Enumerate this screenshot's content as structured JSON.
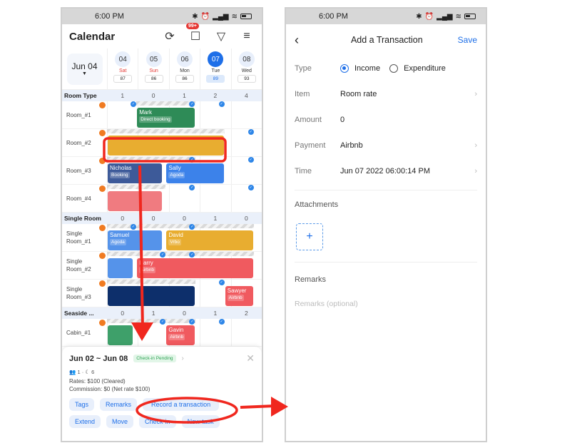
{
  "status_bar": {
    "time": "6:00 PM",
    "icons": [
      "bluetooth-icon",
      "alarm-icon",
      "signal-icon",
      "wifi-icon",
      "battery-icon"
    ]
  },
  "calendar": {
    "title": "Calendar",
    "header_icons": [
      "refresh-icon",
      "inbox-icon",
      "filter-icon",
      "menu-icon"
    ],
    "inbox_badge": "99+",
    "date_picker": {
      "label": "Jun 04"
    },
    "days": [
      {
        "num": "04",
        "name": "Sat",
        "count": "87",
        "weekend": true
      },
      {
        "num": "05",
        "name": "Sun",
        "count": "86",
        "weekend": true
      },
      {
        "num": "06",
        "name": "Mon",
        "count": "86",
        "weekend": false
      },
      {
        "num": "07",
        "name": "Tue",
        "count": "89",
        "today": true
      },
      {
        "num": "08",
        "name": "Wed",
        "count": "93",
        "weekend": false
      }
    ],
    "groups": [
      {
        "name": "Room Type",
        "counts": [
          "1",
          "0",
          "1",
          "2",
          "4"
        ],
        "rooms": [
          "Room_#1",
          "Room_#2",
          "Room_#3",
          "Room_#4"
        ]
      },
      {
        "name": "Single Room",
        "counts": [
          "0",
          "0",
          "0",
          "1",
          "0"
        ],
        "rooms": [
          "Single Room_#1",
          "Single Room_#2",
          "Single Room_#3"
        ]
      },
      {
        "name": "Seaside ...",
        "counts": [
          "0",
          "1",
          "0",
          "1",
          "2"
        ],
        "rooms": [
          "Cabin_#1"
        ]
      }
    ],
    "bookings": [
      {
        "guest": "Mark",
        "source": "Direct booking",
        "color": "#2e8b57"
      },
      {
        "guest": "",
        "source": "",
        "color": "#e8ad30"
      },
      {
        "guest": "Nicholas",
        "source": "Booking",
        "color": "#3d5a99"
      },
      {
        "guest": "Sally",
        "source": "Agoda",
        "color": "#3c82ea"
      },
      {
        "guest": "",
        "source": "",
        "color": "#f07b80"
      },
      {
        "guest": "Samuel",
        "source": "Agoda",
        "color": "#5593ea"
      },
      {
        "guest": "David",
        "source": "Vrbo",
        "color": "#e8ad30"
      },
      {
        "guest": "",
        "source": "",
        "color": "#5593ea"
      },
      {
        "guest": "Harry",
        "source": "Airbnb",
        "color": "#f05a5f"
      },
      {
        "guest": "",
        "source": "",
        "color": "#0d2f6b"
      },
      {
        "guest": "Sawyer",
        "source": "Airbnb",
        "color": "#f05a5f"
      },
      {
        "guest": "",
        "source": "",
        "color": "#3ea06a"
      },
      {
        "guest": "Gavin",
        "source": "Airbnb",
        "color": "#f05a5f"
      }
    ],
    "sheet": {
      "dates": "Jun 02 ~ Jun 08",
      "status": "Check-in Pending",
      "guests": "1",
      "nights": "6",
      "rates": "Rates:  $100 (Cleared)",
      "commission": "Commission:  $0 (Net rate $100)",
      "buttons_row1": [
        "Tags",
        "Remarks",
        "Record a transaction"
      ],
      "buttons_row2": [
        "Extend",
        "Move",
        "Check-in",
        "New task"
      ]
    }
  },
  "transaction": {
    "back": "‹",
    "title": "Add a Transaction",
    "save": "Save",
    "type_label": "Type",
    "type_options": [
      "Income",
      "Expenditure"
    ],
    "type_selected": "Income",
    "item_label": "Item",
    "item_value": "Room rate",
    "amount_label": "Amount",
    "amount_value": "0",
    "payment_label": "Payment",
    "payment_value": "Airbnb",
    "time_label": "Time",
    "time_value": "Jun 07 2022 06:00:14 PM",
    "attachments_label": "Attachments",
    "add_attachment": "+",
    "remarks_label": "Remarks",
    "remarks_placeholder": "Remarks (optional)"
  },
  "colors": {
    "accent": "#1e6fe8",
    "annotation": "#f0271e"
  }
}
